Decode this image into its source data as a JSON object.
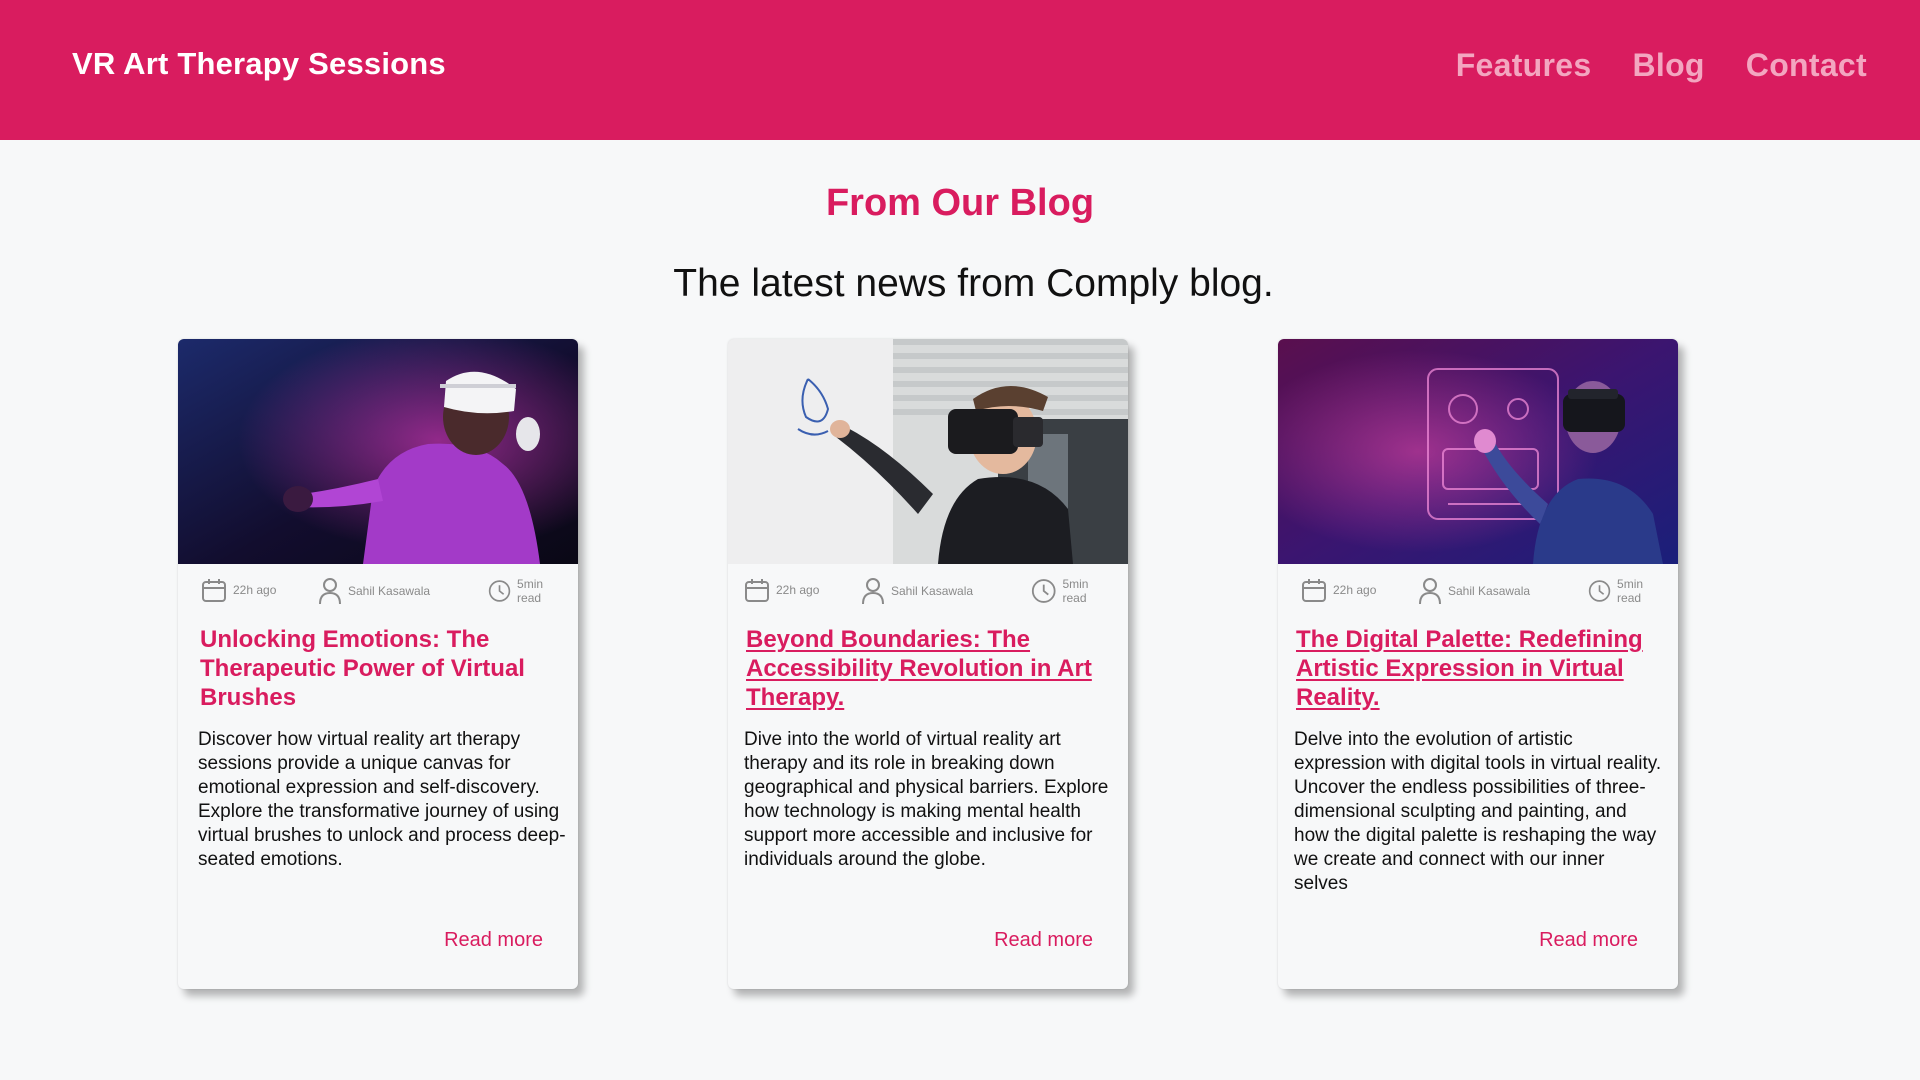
{
  "header": {
    "brand": "VR Art Therapy Sessions",
    "nav": [
      "Features",
      "Blog",
      "Contact"
    ]
  },
  "section": {
    "title": "From Our Blog",
    "subtitle": "The latest news from Comply blog."
  },
  "colors": {
    "accent": "#d91c5f",
    "nav_link": "#f3a6c0",
    "background": "#f7f8f9"
  },
  "posts": [
    {
      "image_desc": "man-in-vr-headset-purple-light",
      "date": "22h ago",
      "author": "Sahil Kasawala",
      "read_time": "5min read",
      "title": "Unlocking Emotions: The Therapeutic Power of Virtual Brushes",
      "text": "Discover how virtual reality art therapy sessions provide a unique canvas for emotional expression and self-discovery. Explore the transformative journey of using virtual brushes to unlock and process deep-seated emotions.",
      "link": "Read more"
    },
    {
      "image_desc": "man-in-vr-headset-drawing-on-whiteboard",
      "date": "22h ago",
      "author": "Sahil Kasawala",
      "read_time": "5min read",
      "title": "Beyond Boundaries: The Accessibility Revolution in Art Therapy.",
      "text": "Dive into the world of virtual reality art therapy and its role in breaking down geographical and physical barriers. Explore how technology is making mental health support more accessible and inclusive for individuals around the globe.",
      "link": "Read more"
    },
    {
      "image_desc": "man-in-vr-headset-holographic-interface",
      "date": "22h ago",
      "author": "Sahil Kasawala",
      "read_time": "5min read",
      "title": "The Digital Palette: Redefining Artistic Expression in Virtual Reality.",
      "text": "Delve into the evolution of artistic expression with digital tools in virtual reality. Uncover the endless possibilities of three-dimensional sculpting and painting, and how the digital palette is reshaping the way we create and connect with our inner selves",
      "link": "Read more"
    }
  ]
}
